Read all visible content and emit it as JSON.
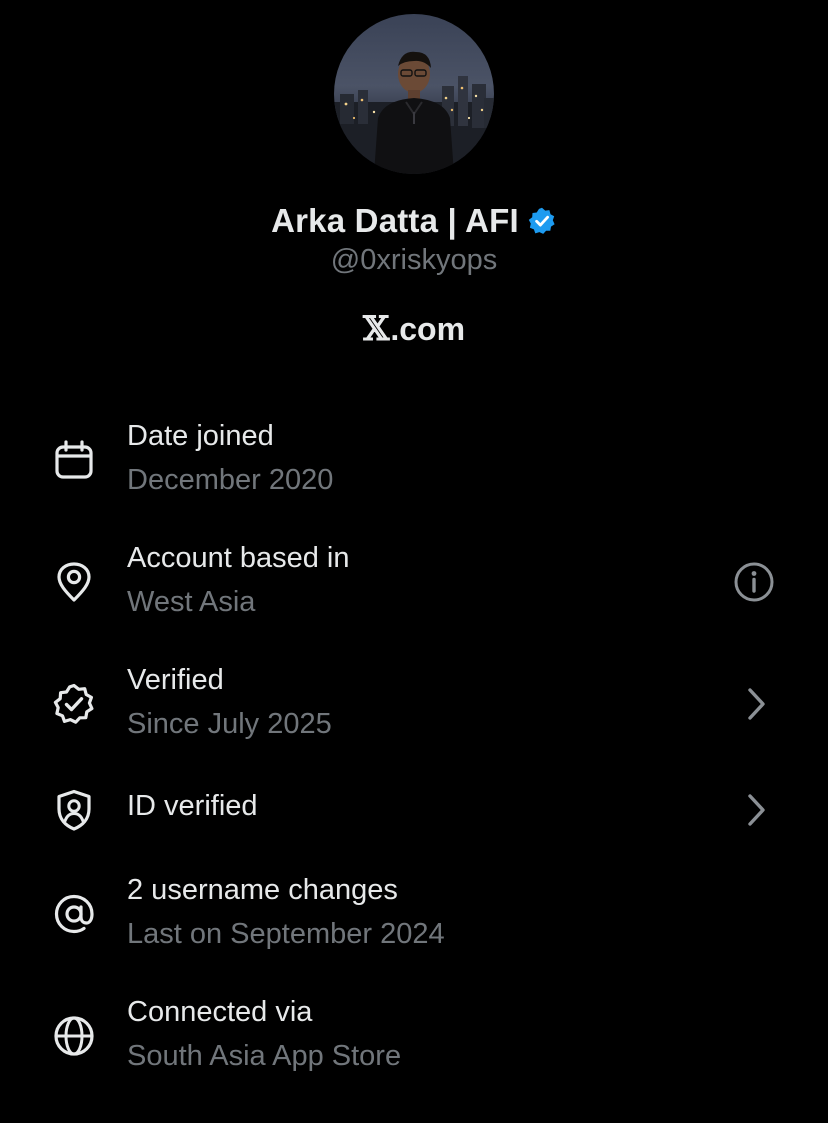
{
  "profile": {
    "display_name": "Arka Datta | AFI",
    "handle": "@0xriskyops",
    "site_glyph": "𝕏",
    "site_suffix": ".com",
    "accent_color": "#1d9bf0",
    "avatar": "profile-photo"
  },
  "rows": [
    {
      "icon": "calendar-icon",
      "title": "Date joined",
      "subtitle": "December 2020",
      "trailing": null
    },
    {
      "icon": "location-pin-icon",
      "title": "Account based in",
      "subtitle": "West Asia",
      "trailing": "info-icon"
    },
    {
      "icon": "verified-badge-icon",
      "title": "Verified",
      "subtitle": "Since July 2025",
      "trailing": "chevron-right-icon"
    },
    {
      "icon": "shield-user-icon",
      "title": "ID verified",
      "subtitle": "",
      "trailing": "chevron-right-icon"
    },
    {
      "icon": "at-sign-icon",
      "title": "2 username changes",
      "subtitle": "Last on September 2024",
      "trailing": null
    },
    {
      "icon": "globe-icon",
      "title": "Connected via",
      "subtitle": "South Asia App Store",
      "trailing": null
    }
  ],
  "colors": {
    "background": "#000000",
    "primary_text": "#e7e9ea",
    "secondary_text": "#71767b",
    "icon": "#e7e9ea",
    "trailing_icon": "#71767b"
  }
}
